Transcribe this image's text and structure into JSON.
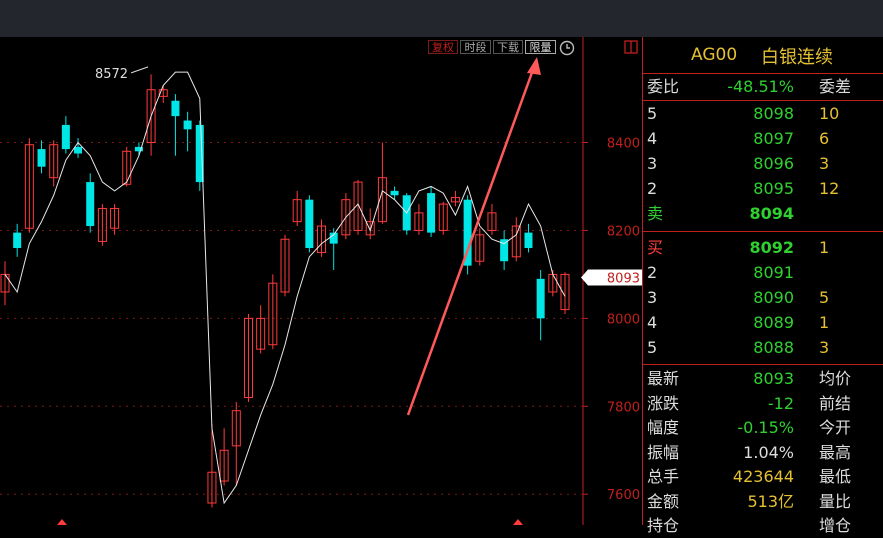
{
  "toolbar": {
    "buttons": [
      {
        "label": "复权",
        "style": "red"
      },
      {
        "label": "时段",
        "style": "normal"
      },
      {
        "label": "下载",
        "style": "normal"
      },
      {
        "label": "限量",
        "style": "highlight"
      }
    ],
    "clock_icon": "clock-icon",
    "panel_toggle_icon": "panel-toggle-icon"
  },
  "chart_data": {
    "type": "candlestick",
    "ylim": [
      7530,
      8640
    ],
    "ticks": [
      {
        "value": 8400,
        "label": "8400"
      },
      {
        "value": 8200,
        "label": "8200"
      },
      {
        "value": 8000,
        "label": "8000"
      },
      {
        "value": 7800,
        "label": "7800"
      },
      {
        "value": 7600,
        "label": "7600"
      }
    ],
    "max_label": "8572",
    "current_price_label": "8093",
    "current_price": 8093,
    "candles": [
      {
        "o": 8060,
        "c": 8100,
        "h": 8130,
        "l": 8030,
        "up": true
      },
      {
        "o": 8195,
        "c": 8160,
        "h": 8215,
        "l": 8140,
        "up": false
      },
      {
        "o": 8205,
        "c": 8395,
        "h": 8410,
        "l": 8195,
        "up": true
      },
      {
        "o": 8385,
        "c": 8345,
        "h": 8405,
        "l": 8330,
        "up": false
      },
      {
        "o": 8320,
        "c": 8395,
        "h": 8405,
        "l": 8300,
        "up": true
      },
      {
        "o": 8385,
        "c": 8440,
        "h": 8460,
        "l": 8375,
        "up": false
      },
      {
        "o": 8390,
        "c": 8375,
        "h": 8410,
        "l": 8365,
        "up": false
      },
      {
        "o": 8310,
        "c": 8210,
        "h": 8330,
        "l": 8195,
        "up": false
      },
      {
        "o": 8175,
        "c": 8250,
        "h": 8260,
        "l": 8165,
        "up": true
      },
      {
        "o": 8250,
        "c": 8205,
        "h": 8260,
        "l": 8190,
        "up": true
      },
      {
        "o": 8305,
        "c": 8380,
        "h": 8390,
        "l": 8300,
        "up": true
      },
      {
        "o": 8380,
        "c": 8390,
        "h": 8400,
        "l": 8370,
        "up": false
      },
      {
        "o": 8400,
        "c": 8520,
        "h": 8555,
        "l": 8370,
        "up": true
      },
      {
        "o": 8520,
        "c": 8505,
        "h": 8530,
        "l": 8490,
        "up": true
      },
      {
        "o": 8495,
        "c": 8460,
        "h": 8510,
        "l": 8370,
        "up": false
      },
      {
        "o": 8430,
        "c": 8450,
        "h": 8470,
        "l": 8380,
        "up": false
      },
      {
        "o": 8440,
        "c": 8310,
        "h": 8450,
        "l": 8290,
        "up": false
      },
      {
        "o": 7580,
        "c": 7650,
        "h": 7760,
        "l": 7570,
        "up": true
      },
      {
        "o": 7630,
        "c": 7700,
        "h": 7750,
        "l": 7620,
        "up": true
      },
      {
        "o": 7710,
        "c": 7790,
        "h": 7810,
        "l": 7620,
        "up": true
      },
      {
        "o": 7820,
        "c": 8000,
        "h": 8010,
        "l": 7810,
        "up": true
      },
      {
        "o": 7930,
        "c": 8000,
        "h": 8030,
        "l": 7920,
        "up": true
      },
      {
        "o": 7940,
        "c": 8080,
        "h": 8100,
        "l": 7930,
        "up": true
      },
      {
        "o": 8060,
        "c": 8180,
        "h": 8190,
        "l": 8050,
        "up": true
      },
      {
        "o": 8220,
        "c": 8270,
        "h": 8290,
        "l": 8210,
        "up": true
      },
      {
        "o": 8270,
        "c": 8160,
        "h": 8280,
        "l": 8150,
        "up": false
      },
      {
        "o": 8150,
        "c": 8210,
        "h": 8225,
        "l": 8140,
        "up": true
      },
      {
        "o": 8195,
        "c": 8170,
        "h": 8205,
        "l": 8110,
        "up": false
      },
      {
        "o": 8190,
        "c": 8270,
        "h": 8285,
        "l": 8180,
        "up": true
      },
      {
        "o": 8200,
        "c": 8310,
        "h": 8315,
        "l": 8190,
        "up": true
      },
      {
        "o": 8190,
        "c": 8220,
        "h": 8250,
        "l": 8180,
        "up": true
      },
      {
        "o": 8220,
        "c": 8320,
        "h": 8400,
        "l": 8215,
        "up": true
      },
      {
        "o": 8280,
        "c": 8290,
        "h": 8300,
        "l": 8270,
        "up": false
      },
      {
        "o": 8280,
        "c": 8200,
        "h": 8285,
        "l": 8190,
        "up": false
      },
      {
        "o": 8200,
        "c": 8240,
        "h": 8260,
        "l": 8190,
        "up": true
      },
      {
        "o": 8285,
        "c": 8195,
        "h": 8300,
        "l": 8185,
        "up": false
      },
      {
        "o": 8200,
        "c": 8260,
        "h": 8265,
        "l": 8190,
        "up": true
      },
      {
        "o": 8265,
        "c": 8275,
        "h": 8290,
        "l": 8255,
        "up": true
      },
      {
        "o": 8270,
        "c": 8120,
        "h": 8280,
        "l": 8100,
        "up": false
      },
      {
        "o": 8130,
        "c": 8190,
        "h": 8205,
        "l": 8120,
        "up": true
      },
      {
        "o": 8200,
        "c": 8240,
        "h": 8260,
        "l": 8190,
        "up": true
      },
      {
        "o": 8180,
        "c": 8130,
        "h": 8200,
        "l": 8110,
        "up": false
      },
      {
        "o": 8140,
        "c": 8210,
        "h": 8230,
        "l": 8130,
        "up": true
      },
      {
        "o": 8195,
        "c": 8160,
        "h": 8215,
        "l": 8150,
        "up": false
      },
      {
        "o": 8090,
        "c": 8000,
        "h": 8110,
        "l": 7950,
        "up": false
      },
      {
        "o": 8060,
        "c": 8100,
        "h": 8110,
        "l": 8050,
        "up": true
      },
      {
        "o": 8100,
        "c": 8020,
        "h": 8105,
        "l": 8010,
        "up": true
      }
    ],
    "ma_line": [
      8100,
      8060,
      8170,
      8220,
      8280,
      8360,
      8400,
      8370,
      8310,
      8290,
      8310,
      8370,
      8460,
      8530,
      8560,
      8560,
      8500,
      7750,
      7580,
      7620,
      7700,
      7780,
      7850,
      7940,
      8050,
      8140,
      8170,
      8190,
      8230,
      8260,
      8200,
      8290,
      8270,
      8240,
      8290,
      8300,
      8285,
      8235,
      8300,
      8210,
      8180,
      8170,
      8190,
      8260,
      8210,
      8100,
      8050
    ]
  },
  "quote": {
    "code": "AG00",
    "name": "白银连续",
    "weibi_label": "委比",
    "weibi_value": "-48.51%",
    "weicha_label": "委差",
    "sell_label": "卖",
    "buy_label": "买",
    "asks": [
      {
        "level": "5",
        "price": "8098",
        "vol": "10"
      },
      {
        "level": "4",
        "price": "8097",
        "vol": "6"
      },
      {
        "level": "3",
        "price": "8096",
        "vol": "3"
      },
      {
        "level": "2",
        "price": "8095",
        "vol": "12"
      },
      {
        "level": "卖",
        "price": "8094",
        "vol": ""
      }
    ],
    "bids": [
      {
        "level": "买",
        "price": "8092",
        "vol": "1"
      },
      {
        "level": "2",
        "price": "8091",
        "vol": ""
      },
      {
        "level": "3",
        "price": "8090",
        "vol": "5"
      },
      {
        "level": "4",
        "price": "8089",
        "vol": "1"
      },
      {
        "level": "5",
        "price": "8088",
        "vol": "3"
      }
    ],
    "stats": [
      {
        "label": "最新",
        "value": "8093",
        "color": "green",
        "label2": "均价"
      },
      {
        "label": "涨跌",
        "value": "-12",
        "color": "green",
        "label2": "前结"
      },
      {
        "label": "幅度",
        "value": "-0.15%",
        "color": "green",
        "label2": "今开"
      },
      {
        "label": "振幅",
        "value": "1.04%",
        "color": "white",
        "label2": "最高"
      },
      {
        "label": "总手",
        "value": "423644",
        "color": "yellow",
        "label2": "最低"
      },
      {
        "label": "金额",
        "value": "513亿",
        "color": "yellow",
        "label2": "量比"
      },
      {
        "label": "持仓",
        "value": "",
        "color": "yellow",
        "label2": "增仓"
      }
    ]
  }
}
